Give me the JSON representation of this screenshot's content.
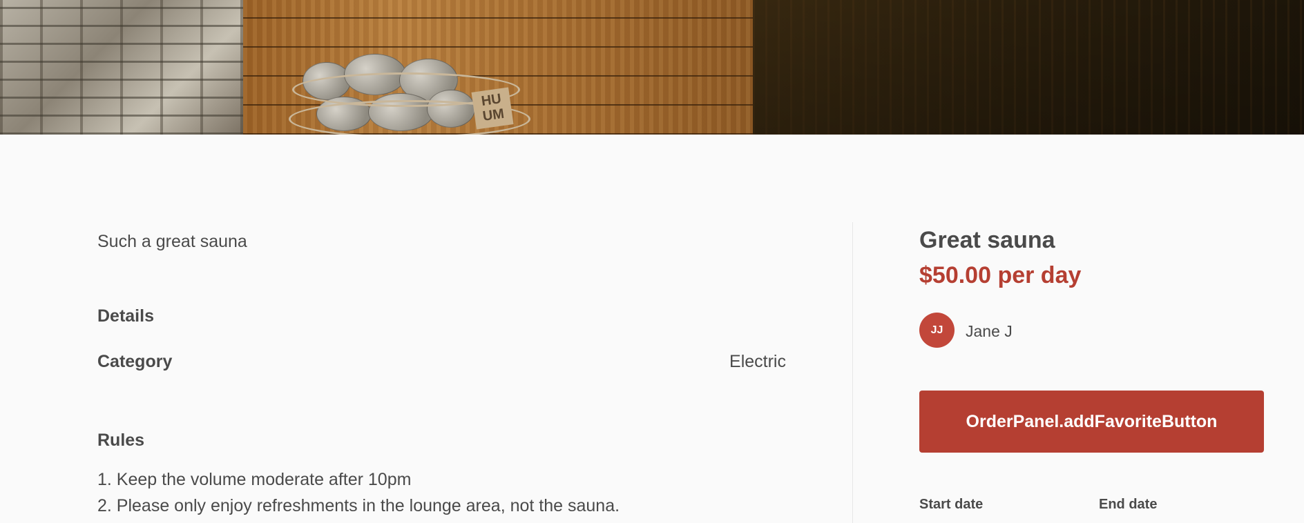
{
  "hero": {
    "heater_logo": "HU\nUM"
  },
  "listing": {
    "description": "Such a great sauna",
    "details_title": "Details",
    "category_label": "Category",
    "category_value": "Electric",
    "rules_title": "Rules",
    "rules": [
      "1. Keep the volume moderate after 10pm",
      "2. Please only enjoy refreshments in the lounge area, not the sauna."
    ]
  },
  "order_panel": {
    "title": "Great sauna",
    "price": "$50.00 per day",
    "author_initials": "JJ",
    "author_name": "Jane J",
    "favorite_button_label": "OrderPanel.addFavoriteButton",
    "start_date_label": "Start date",
    "end_date_label": "End date"
  },
  "colors": {
    "accent": "#b53f32",
    "text": "#4a4a4a",
    "background": "#fafafa"
  }
}
